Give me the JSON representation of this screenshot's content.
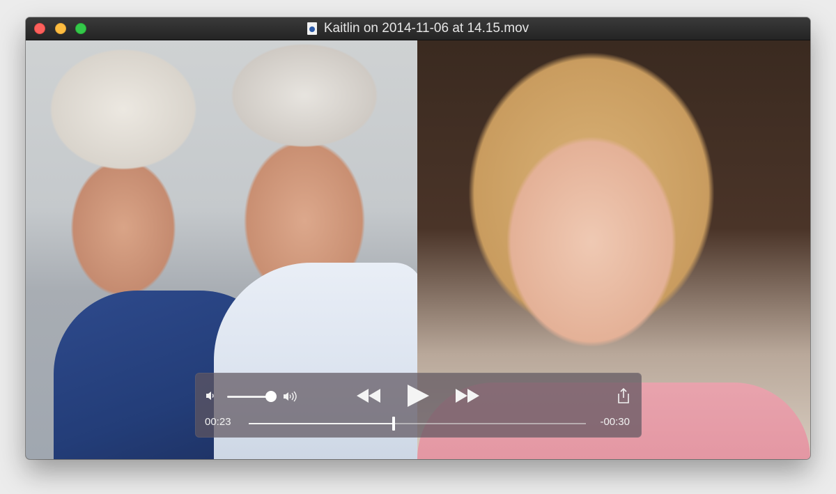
{
  "window": {
    "title": "Kaitlin on 2014-11-06 at 14.15.mov",
    "buttons": [
      "close",
      "minimize",
      "zoom"
    ],
    "title_icon": "document-icon"
  },
  "controls": {
    "volume_low_icon": "speaker-low-icon",
    "volume_high_icon": "speaker-high-icon",
    "volume_level": 0.75,
    "rewind_icon": "rewind-icon",
    "play_icon": "play-icon",
    "fast_forward_icon": "fast-forward-icon",
    "share_icon": "share-icon",
    "elapsed": "00:23",
    "remaining": "-00:30",
    "playback_progress": 0.43
  },
  "colors": {
    "close": "#fc605c",
    "minimize": "#fdbc40",
    "zoom": "#34c84a"
  }
}
